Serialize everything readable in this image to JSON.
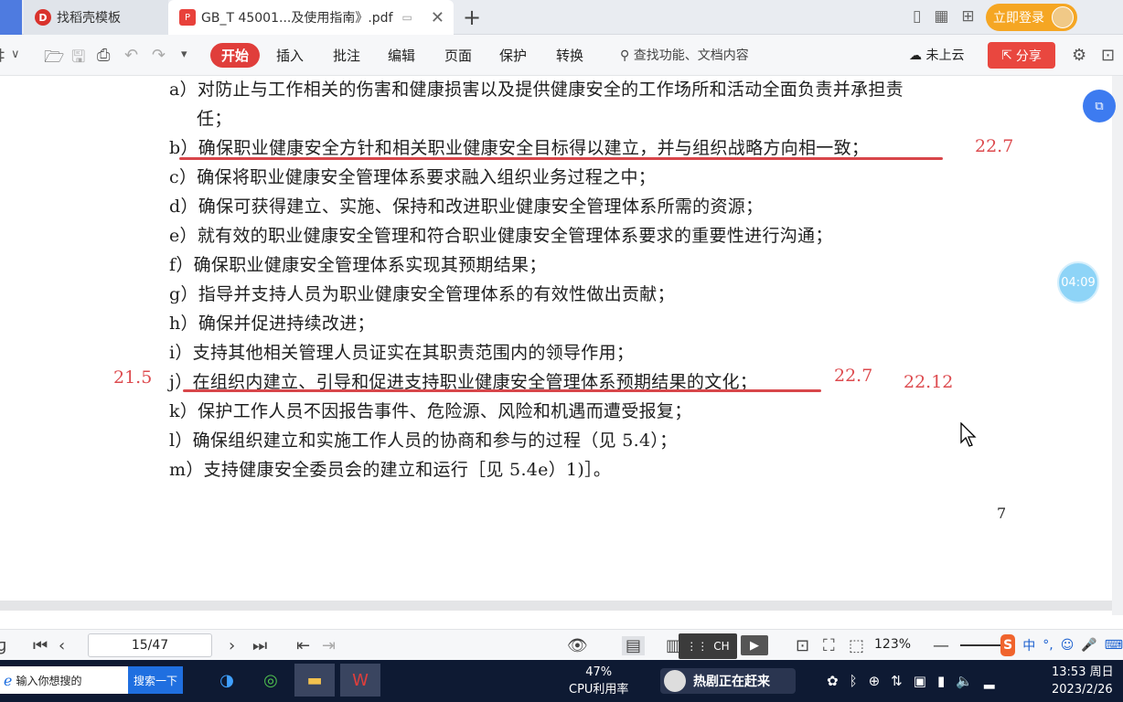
{
  "tabs": {
    "template_label": "找稻壳模板",
    "pdf_label": "GB_T 45001...及使用指南》.pdf",
    "new_tab": "+"
  },
  "header": {
    "login_label": "立即登录"
  },
  "toolbar": {
    "menus": [
      "开始",
      "插入",
      "批注",
      "编辑",
      "页面",
      "保护",
      "转换"
    ],
    "search_placeholder": "查找功能、文档内容",
    "cloud_label": "未上云",
    "share_label": "分享"
  },
  "document": {
    "lines": [
      "a）对防止与工作相关的伤害和健康损害以及提供健康安全的工作场所和活动全面负责并承担责",
      "任；",
      "b）确保职业健康安全方针和相关职业健康安全目标得以建立，并与组织战略方向相一致；",
      "c）确保将职业健康安全管理体系要求融入组织业务过程之中；",
      "d）确保可获得建立、实施、保持和改进职业健康安全管理体系所需的资源；",
      "e）就有效的职业健康安全管理和符合职业健康安全管理体系要求的重要性进行沟通；",
      "f）确保职业健康安全管理体系实现其预期结果；",
      "g）指导并支持人员为职业健康安全管理体系的有效性做出贡献；",
      "h）确保并促进持续改进；",
      "i）支持其他相关管理人员证实在其职责范围内的领导作用；",
      "j）在组织内建立、引导和促进支持职业健康安全管理体系预期结果的文化；",
      "k）保护工作人员不因报告事件、危险源、风险和机遇而遭受报复；",
      "l）确保组织建立和实施工作人员的协商和参与的过程（见 5.4）；",
      "m）支持健康安全委员会的建立和运行［见 5.4e）1)］。"
    ],
    "annotations": {
      "b_right": "22.7",
      "j_left": "21.5",
      "j_right1": "22.7",
      "j_right2": "22.12"
    },
    "page_number": "7"
  },
  "overlays": {
    "timer": "04:09"
  },
  "statusbar": {
    "page_field": "15/47",
    "ime_label": "CH",
    "zoom": "123%",
    "sogou_items": [
      "S",
      "中",
      "°,",
      "☺",
      "🎤",
      "⌨"
    ]
  },
  "taskbar": {
    "search_placeholder": "输入你想搜的",
    "search_button": "搜索一下",
    "cpu_percent": "47%",
    "cpu_label": "CPU利用率",
    "news_label": "热剧正在赶来",
    "time": "13:53 周日",
    "date": "2023/2/26"
  }
}
